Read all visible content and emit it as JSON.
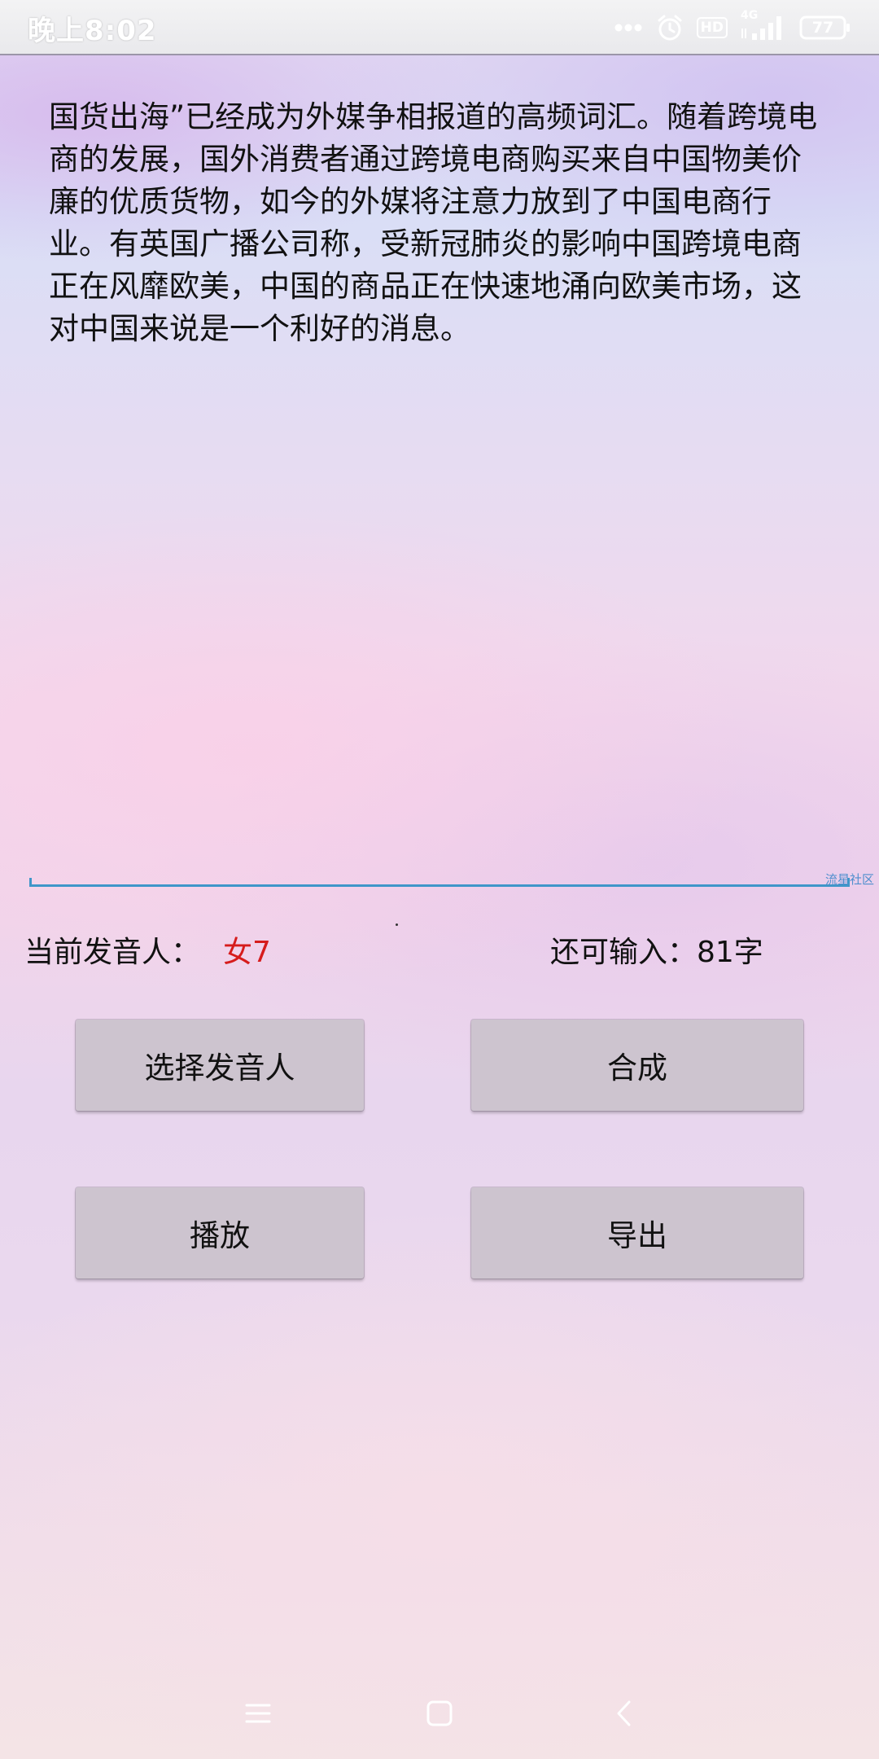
{
  "status_bar": {
    "time": "晚上8:02",
    "hd_label": "HD",
    "network_label": "4G",
    "battery_level": "77",
    "icons": [
      "more-dots-icon",
      "alarm-icon",
      "hd-icon",
      "signal-icon",
      "battery-icon"
    ]
  },
  "text_input": {
    "content": "国货出海”已经成为外媒争相报道的高频词汇。随着跨境电商的发展，国外消费者通过跨境电商购买来自中国物美价廉的优质货物，如今的外媒将注意力放到了中国电商行业。有英国广播公司称，受新冠肺炎的影响中国跨境电商正在风靡欧美，中国的商品正在快速地涌向欧美市场，这对中国来说是一个利好的消息。"
  },
  "watermark": "流星社区",
  "speaker": {
    "label": "当前发音人：",
    "value": "女7"
  },
  "remaining": {
    "text": "还可输入：81字"
  },
  "buttons": {
    "select_speaker": "选择发音人",
    "synthesize": "合成",
    "play": "播放",
    "export": "导出"
  },
  "nav_bar": {
    "icons": [
      "menu-icon",
      "home-icon",
      "back-icon"
    ]
  },
  "colors": {
    "accent_underline": "#3f96c9",
    "speaker_value": "#d61c1c",
    "button_bg": "#cdc4cf"
  }
}
